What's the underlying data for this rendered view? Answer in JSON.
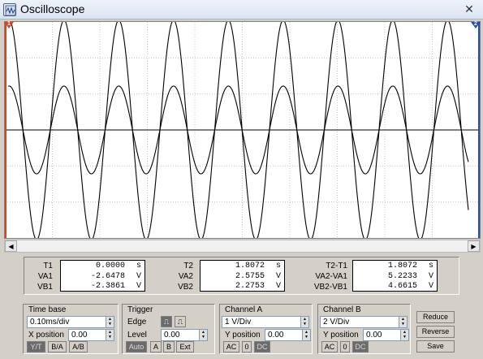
{
  "window": {
    "title": "Oscilloscope",
    "close_glyph": "✕",
    "icon": "oscilloscope-icon"
  },
  "markers": {
    "t1": "1",
    "t2": "2",
    "t1_color": "#e04020",
    "t2_color": "#2050c0"
  },
  "readouts": {
    "col1": {
      "labels": [
        "T1",
        "VA1",
        "VB1"
      ],
      "values": [
        "0.0000",
        "-2.6478",
        "-2.3861"
      ],
      "units": [
        "s",
        "V",
        "V"
      ]
    },
    "col2": {
      "labels": [
        "T2",
        "VA2",
        "VB2"
      ],
      "values": [
        "1.8072",
        "2.5755",
        "2.2753"
      ],
      "units": [
        "s",
        "V",
        "V"
      ]
    },
    "col3": {
      "labels": [
        "T2-T1",
        "VA2-VA1",
        "VB2-VB1"
      ],
      "values": [
        "1.8072",
        "5.2233",
        "4.6615"
      ],
      "units": [
        "s",
        "V",
        "V"
      ]
    }
  },
  "timebase": {
    "title": "Time base",
    "value": "0.10ms/div",
    "xpos_label": "X position",
    "xpos": "0.00",
    "buttons": [
      "Y/T",
      "B/A",
      "A/B"
    ]
  },
  "trigger": {
    "title": "Trigger",
    "edge_label": "Edge",
    "level_label": "Level",
    "level": "0.00",
    "buttons": [
      "Auto",
      "A",
      "B",
      "Ext"
    ]
  },
  "channel_a": {
    "title": "Channel A",
    "value": "1 V/Div",
    "ypos_label": "Y position",
    "ypos": "0.00",
    "buttons": [
      "AC",
      "0",
      "DC"
    ]
  },
  "channel_b": {
    "title": "Channel B",
    "value": "2 V/Div",
    "ypos_label": "Y position",
    "ypos": "0.00",
    "buttons": [
      "AC",
      "0",
      "DC"
    ]
  },
  "actions": [
    "Reduce",
    "Reverse",
    "Save"
  ],
  "waveforms": {
    "periods": 8.4,
    "phase": -0.02,
    "channel_a_amplitude_divs": 1.22,
    "channel_b_amplitude_divs": 3.05,
    "grid_color": "#c8c8c8",
    "trace_color": "#000000"
  }
}
